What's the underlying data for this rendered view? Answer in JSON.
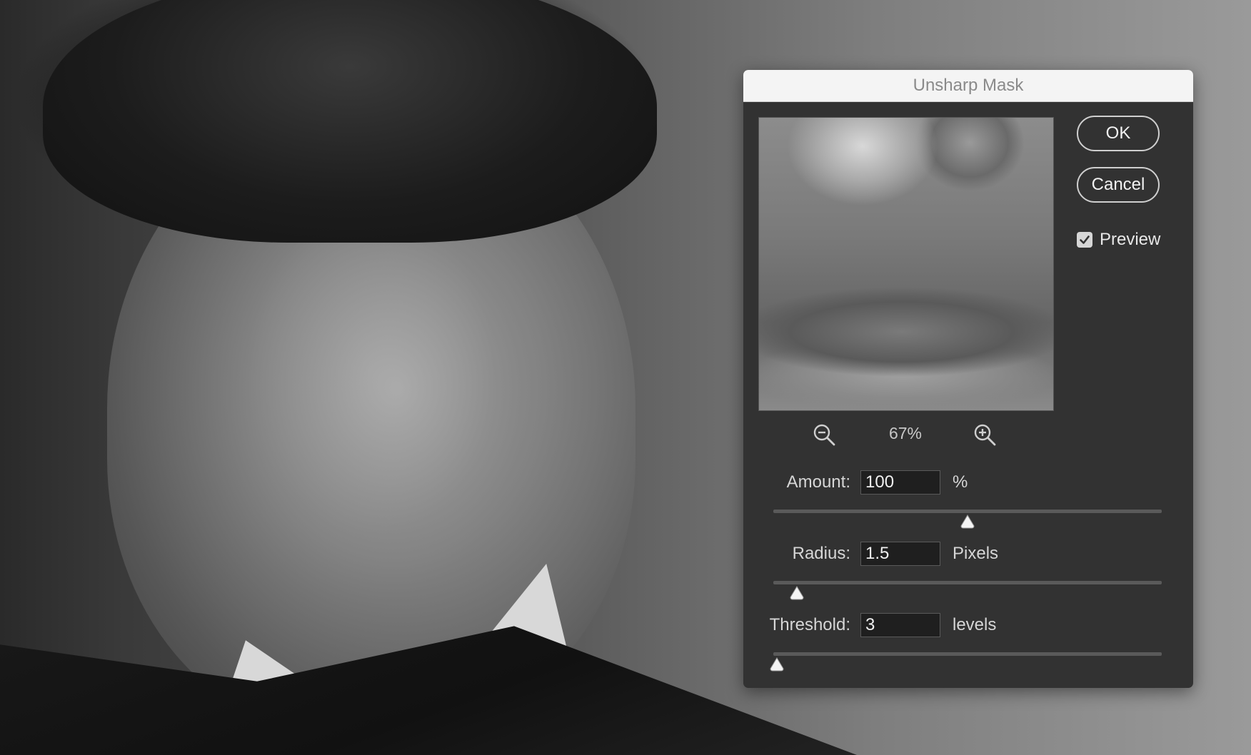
{
  "dialog": {
    "title": "Unsharp Mask",
    "ok_label": "OK",
    "cancel_label": "Cancel",
    "preview_label": "Preview",
    "preview_checked": true,
    "zoom_level": "67%"
  },
  "params": {
    "amount": {
      "label": "Amount:",
      "value": "100",
      "unit": "%",
      "slider_fraction": 0.5
    },
    "radius": {
      "label": "Radius:",
      "value": "1.5",
      "unit": "Pixels",
      "slider_fraction": 0.06
    },
    "threshold": {
      "label": "Threshold:",
      "value": "3",
      "unit": "levels",
      "slider_fraction": 0.01
    }
  },
  "colors": {
    "dialog_bg": "#323232",
    "titlebar_bg": "#f4f4f4",
    "title_text": "#8a8a8a",
    "accent_text": "#f2f2f2"
  },
  "icons": {
    "zoom_out": "magnifier-minus-icon",
    "zoom_in": "magnifier-plus-icon",
    "check": "checkmark-icon",
    "thumb": "slider-triangle-thumb-icon"
  }
}
